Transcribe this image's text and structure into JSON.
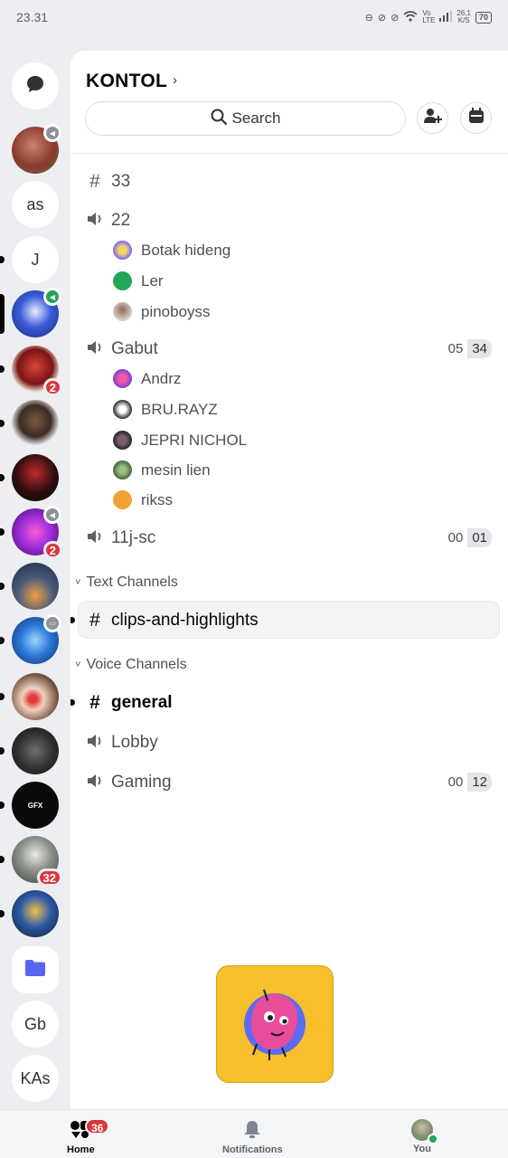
{
  "status_bar": {
    "time": "23.31",
    "net_speed": "26,1",
    "net_unit": "K/S",
    "battery": "70"
  },
  "colors": {
    "accent": "#5865f2",
    "badge": "#da373c",
    "voice_active": "#23a55a",
    "promo_bg": "#f6bf2b"
  },
  "rail": {
    "text_guilds": [
      "as",
      "J",
      "Gb",
      "KAs"
    ],
    "badges": [
      "2",
      "2",
      "32"
    ],
    "folder_icon": "folder-icon",
    "dm_icon": "chat-bubble-icon"
  },
  "server": {
    "title": "KONTOL",
    "search_label": "Search"
  },
  "channels": {
    "top": [
      {
        "type": "text",
        "name": "33"
      },
      {
        "type": "voice",
        "name": "22",
        "members": [
          "Botak hideng",
          "Ler",
          "pinoboyss"
        ]
      },
      {
        "type": "voice",
        "name": "Gabut",
        "count_left": "05",
        "count_right": "34",
        "members": [
          "Andrz",
          "BRU.RAYZ",
          "JEPRI NICHOL",
          "mesin lien",
          "rikss"
        ]
      },
      {
        "type": "voice",
        "name": "11j-sc",
        "count_left": "00",
        "count_right": "01"
      }
    ],
    "text_category": {
      "label": "Text Channels",
      "items": [
        {
          "type": "text",
          "name": "clips-and-highlights"
        }
      ]
    },
    "voice_category": {
      "label": "Voice Channels",
      "items": [
        {
          "type": "text",
          "name": "general"
        },
        {
          "type": "voice",
          "name": "Lobby"
        },
        {
          "type": "voice",
          "name": "Gaming",
          "count_left": "00",
          "count_right": "12"
        }
      ]
    }
  },
  "bottom_nav": {
    "home": {
      "label": "Home",
      "badge": "36"
    },
    "notifications": {
      "label": "Notifications"
    },
    "you": {
      "label": "You"
    }
  }
}
